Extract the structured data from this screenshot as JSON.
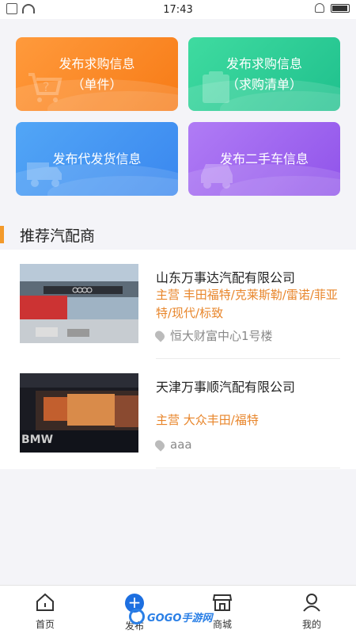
{
  "status_bar": {
    "time": "17:43"
  },
  "cards": [
    {
      "line1": "发布求购信息",
      "line2": "（单件）"
    },
    {
      "line1": "发布求购信息",
      "line2": "（求购清单）"
    },
    {
      "line1": "发布代发货信息",
      "line2": ""
    },
    {
      "line1": "发布二手车信息",
      "line2": ""
    }
  ],
  "section": {
    "title": "推荐汽配商"
  },
  "dealers": [
    {
      "name": "山东万事达汽配有限公司",
      "main": "主营 丰田福特/克莱斯勒/雷诺/菲亚特/现代/标致",
      "address": "恒大财富中心1号楼"
    },
    {
      "name": "天津万事顺汽配有限公司",
      "main": "主营 大众丰田/福特",
      "address": "aaa"
    }
  ],
  "bottom_nav": [
    {
      "label": "首页",
      "icon": "home-icon"
    },
    {
      "label": "发布",
      "icon": "plus-icon"
    },
    {
      "label": "商城",
      "icon": "shop-icon"
    },
    {
      "label": "我的",
      "icon": "user-icon"
    }
  ],
  "watermark": {
    "text": "GOGO手游网"
  }
}
